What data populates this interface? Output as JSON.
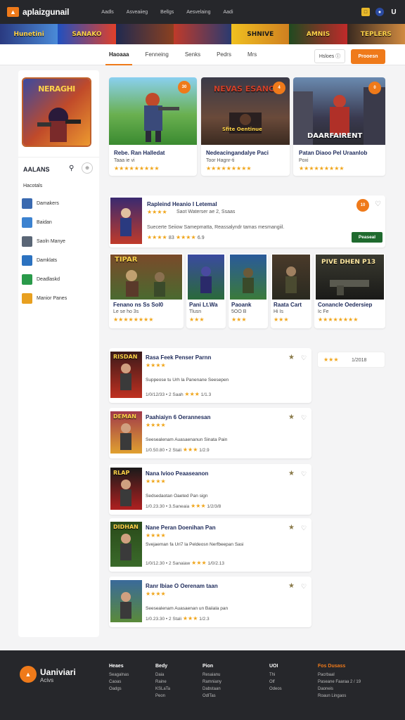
{
  "header": {
    "logo_text": "aplaizgunail",
    "nav": [
      "Aadls",
      "Asveaiieg",
      "Bellgs",
      "Aesvelaing",
      "Aadi"
    ],
    "icon_text": "U"
  },
  "banner": {
    "segments": [
      "Hunetini",
      "SANAKO",
      "",
      "",
      "SHNIVE",
      "AMNIS",
      "TEPLERS"
    ]
  },
  "subnav": {
    "tabs": [
      "Haoaaa",
      "Fenneing",
      "Senks",
      "Pedrs",
      "Mrs"
    ],
    "active_tab": 0,
    "button_secondary": "Hsloes",
    "button_primary": "Prooesn"
  },
  "sidebar": {
    "featured_title": "NERAGHI",
    "heading": "AALANS",
    "subheading": "Hacotals",
    "items": [
      {
        "label": "Damakers",
        "color": "#3a6ab0"
      },
      {
        "label": "Baidan",
        "color": "#3c82d0"
      },
      {
        "label": "Saoln Manye",
        "color": "#5a6676"
      },
      {
        "label": "Damklats",
        "color": "#2c72c0"
      },
      {
        "label": "Deadlaskd",
        "color": "#2a9a4a"
      },
      {
        "label": "Manior Panes",
        "color": "#e8a020"
      }
    ]
  },
  "top_cards": [
    {
      "title": "Rebe. Ran Halledat",
      "sub": "Taaa ie vi",
      "badge": "30",
      "game_text": ""
    },
    {
      "title": "Nedeacingandalye Paci",
      "sub": "Toor Hagnr-ti",
      "badge": "4",
      "game_text": "NEVAS ESANCE",
      "game_sub": "Sfite Oentinue"
    },
    {
      "title": "Patan Diaoo Pel Uraanlob",
      "sub": "Poxi",
      "badge": "0",
      "game_text": "DAARFAIRENT"
    }
  ],
  "feature_row": {
    "title": "Rapleind Heanio I Letemal",
    "sub": "Saot Waterser ae 2, Ssaas",
    "desc": "Suecerte Seiiow Samepmatta, Reassalyndr tamas mesmangiil.",
    "meta": "83",
    "meta2": "6.9",
    "badge": "10",
    "button": "Peaseal"
  },
  "grid_cards": [
    {
      "title": "Fenano ns Ss Sol0",
      "sub": "Le se ho 3s",
      "game_text": "TIPAR"
    },
    {
      "title": "Pani Lt.Wa",
      "sub": "Tlusn",
      "game_text": ""
    },
    {
      "title": "Paoank",
      "sub": "5OO B",
      "game_text": ""
    },
    {
      "title": "Raata Cart",
      "sub": "Hi Is",
      "game_text": ""
    },
    {
      "title": "Conancle Oedersiep",
      "sub": "Ic Fe",
      "game_text": "PIVE DHEN P13"
    }
  ],
  "list_rows": [
    {
      "title": "Rasa Feek Penser Parnn",
      "desc": "Suppeose tu Urh la Panenane Seesepen",
      "meta": "1/0/12/33  •  2 Saah",
      "num": "1/1.3",
      "game_text": "RISDAN"
    },
    {
      "title": "Paahiaiyn 6 Oerannesan",
      "desc": "Seesealenam Auasaenanun Sinata Pain",
      "meta": "1/0.50.80  •  2 Stali",
      "num": "1/2.9",
      "game_text": "DEMAN"
    },
    {
      "title": "Nana Ivioo Peaaseanon",
      "desc": "Sedsedaotan Oaeted Pan sign",
      "meta": "1/0.23.30  •  3.Saneaia",
      "num": "1/2/3/8",
      "game_text": "RLAP"
    },
    {
      "title": "Nane Peran Doenihan Pan",
      "desc": "Svejaeman fa Uri7 la Peldeosn Nerfbeepan Sasi",
      "meta": "1/0/12.30  •  2 Sanaiaw",
      "num": "1/0/2.13",
      "game_text": "DIDHAN"
    },
    {
      "title": "Ranr Ibiae O Oerenam taan",
      "desc": "Seesealenam Auasaenan un Baiiala pan",
      "meta": "1/0.23.30  •  2 Stali",
      "num": "1/2.3",
      "game_text": ""
    }
  ],
  "side_widget": {
    "value": "1/2018"
  },
  "footer": {
    "brand": "Uaniviari",
    "brand_sub": "Acivs",
    "columns": [
      {
        "head": "Heaes",
        "items": [
          "Seagalnas",
          "Caoas",
          "Oadgs"
        ]
      },
      {
        "head": "Bedy",
        "items": [
          "Daia",
          "Raine",
          "KSLaTa",
          "Peon"
        ]
      },
      {
        "head": "Pion",
        "items": [
          "Resaianu",
          "Ramniany",
          "Dabstaan",
          "OdlTas"
        ]
      },
      {
        "head": "UOI",
        "items": [
          "Thi",
          "Olf",
          "Odeos"
        ]
      },
      {
        "head": "Fos Dusass",
        "items": [
          "Pacrbaal",
          "Paseane Faaraa 2 / 19",
          "Daoneis",
          "Roaun Lingaos"
        ]
      }
    ]
  },
  "colors": {
    "accent": "#ef7a1a",
    "dark": "#26272b",
    "title": "#1d2a5a",
    "star": "#f0a51a",
    "green_btn": "#1f6a2e"
  }
}
